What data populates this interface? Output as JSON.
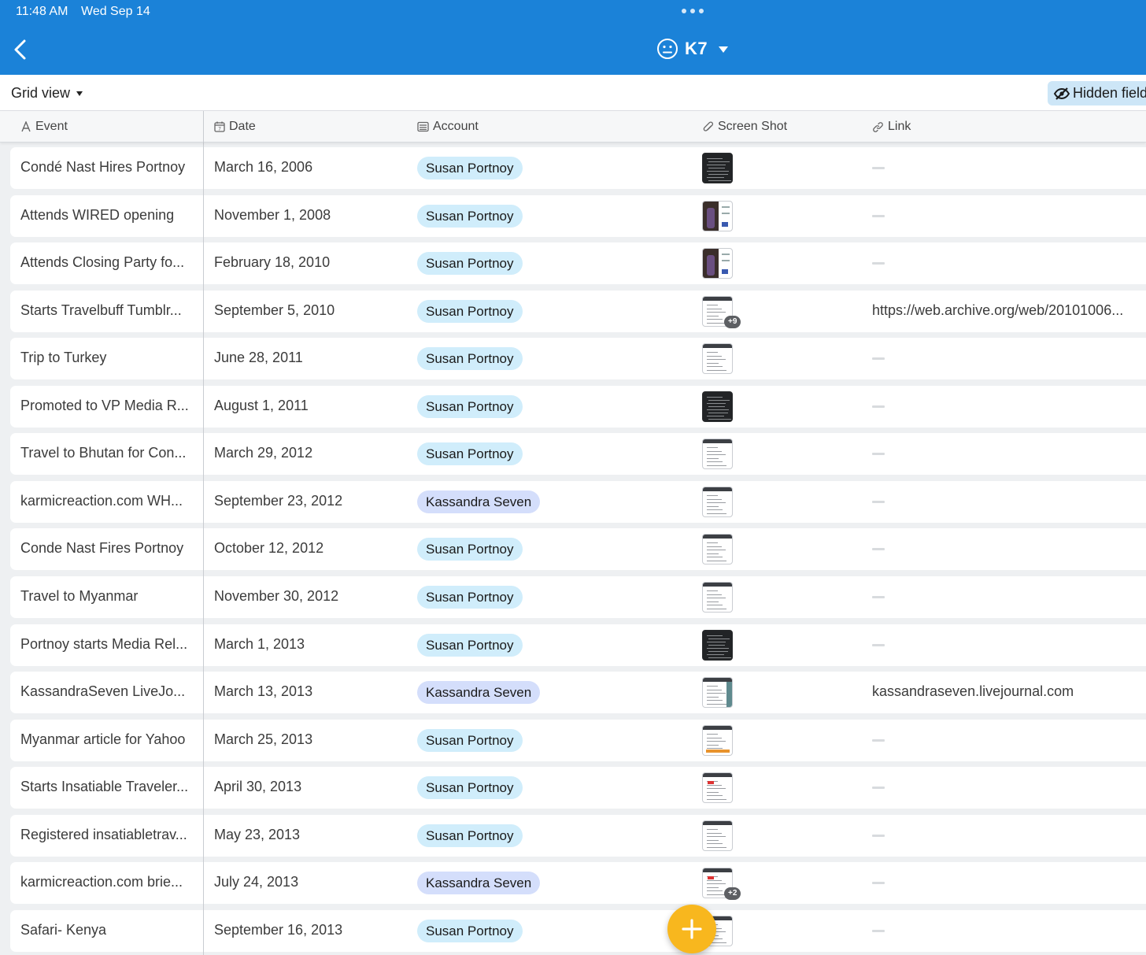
{
  "status_bar": {
    "time": "11:48 AM",
    "date": "Wed Sep 14"
  },
  "header": {
    "base_name": "K7",
    "back_icon": "chevron-left-icon",
    "base_icon": "neutral-face-icon",
    "color": "#1b82d8"
  },
  "viewbar": {
    "view_name": "Grid view",
    "hidden_fields_label": "Hidden fields"
  },
  "columns": {
    "event": "Event",
    "date": "Date",
    "account": "Account",
    "screenshot": "Screen Shot",
    "link": "Link"
  },
  "rows": [
    {
      "event": "Condé Nast Hires Portnoy",
      "date": "March 16, 2006",
      "account": "Susan Portnoy",
      "thumb": "dark",
      "link": ""
    },
    {
      "event": "Attends WIRED opening",
      "date": "November 1, 2008",
      "account": "Susan Portnoy",
      "thumb": "photo",
      "link": ""
    },
    {
      "event": "Attends Closing Party fo...",
      "date": "February 18, 2010",
      "account": "Susan Portnoy",
      "thumb": "photo",
      "link": ""
    },
    {
      "event": "Starts Travelbuff Tumblr...",
      "date": "September 5, 2010",
      "account": "Susan Portnoy",
      "thumb": "page",
      "badge": "+9",
      "link": "https://web.archive.org/web/20101006..."
    },
    {
      "event": "Trip to Turkey",
      "date": "June 28, 2011",
      "account": "Susan Portnoy",
      "thumb": "page",
      "link": ""
    },
    {
      "event": "Promoted to VP Media R...",
      "date": "August 1, 2011",
      "account": "Susan Portnoy",
      "thumb": "dark",
      "link": ""
    },
    {
      "event": "Travel to Bhutan for Con...",
      "date": "March 29, 2012",
      "account": "Susan Portnoy",
      "thumb": "page",
      "link": ""
    },
    {
      "event": "karmicreaction.com WH...",
      "date": "September 23, 2012",
      "account": "Kassandra Seven",
      "thumb": "page",
      "link": ""
    },
    {
      "event": "Conde Nast Fires Portnoy",
      "date": "October 12, 2012",
      "account": "Susan Portnoy",
      "thumb": "page",
      "link": ""
    },
    {
      "event": "Travel to Myanmar",
      "date": "November 30, 2012",
      "account": "Susan Portnoy",
      "thumb": "page",
      "link": ""
    },
    {
      "event": "Portnoy starts Media Rel...",
      "date": "March 1, 2013",
      "account": "Susan Portnoy",
      "thumb": "dark",
      "link": ""
    },
    {
      "event": "KassandraSeven LiveJo...",
      "date": "March 13, 2013",
      "account": "Kassandra Seven",
      "thumb": "page",
      "link": "kassandraseven.livejournal.com"
    },
    {
      "event": "Myanmar article for Yahoo",
      "date": "March 25, 2013",
      "account": "Susan Portnoy",
      "thumb": "page",
      "link": ""
    },
    {
      "event": "Starts Insatiable Traveler...",
      "date": "April 30, 2013",
      "account": "Susan Portnoy",
      "thumb": "page",
      "link": ""
    },
    {
      "event": "Registered insatiabletrav...",
      "date": "May 23, 2013",
      "account": "Susan Portnoy",
      "thumb": "page",
      "link": ""
    },
    {
      "event": "karmicreaction.com brie...",
      "date": "July 24, 2013",
      "account": "Kassandra Seven",
      "thumb": "page",
      "badge": "+2",
      "link": ""
    },
    {
      "event": "Safari- Kenya",
      "date": "September 16, 2013",
      "account": "Susan Portnoy",
      "thumb": "page",
      "link": ""
    }
  ],
  "account_colors": {
    "Susan Portnoy": "#d0edfb",
    "Kassandra Seven": "#d4defb"
  },
  "fab": {
    "icon": "plus-icon",
    "color": "#f8b71e"
  }
}
